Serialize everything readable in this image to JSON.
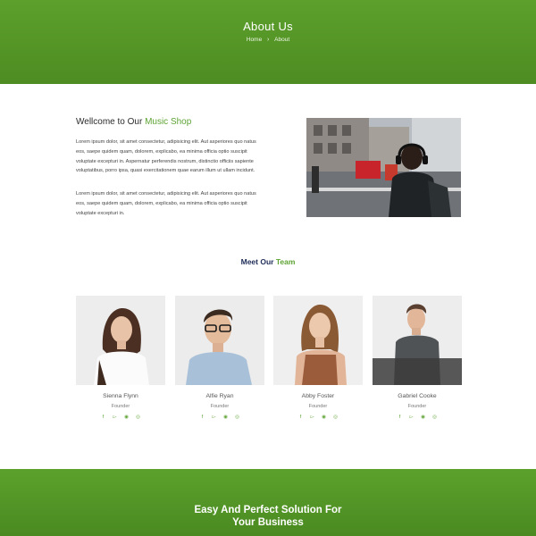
{
  "hero": {
    "title": "About Us",
    "breadcrumb": {
      "home": "Home",
      "separator": "›",
      "current": "About"
    }
  },
  "welcome": {
    "title_prefix": "Wellcome to Our ",
    "title_accent": "Music Shop",
    "paragraph_1": "Lorem ipsum dolor, sit amet consectetur, adipisicing elit. Aut asperiores quo natus eos, saepe quidem quam, dolorem, explicabo, ea minima officia optio suscipit voluptate excepturi in. Aspernatur perferendis nostrum, distinctio officiis sapiente voluptatibus, porro ipsa, quasi exercitationem quae earum illum ut ullam incidunt.",
    "paragraph_2": "Lorem ipsum dolor, sit amet consectetur, adipisicing elit. Aut asperiores quo natus eos, saepe quidem quam, dolorem, explicabo, ea minima officia optio suscipit voluptate excepturi in."
  },
  "team": {
    "title_prefix": "Meet Our ",
    "title_accent": "Team",
    "members": [
      {
        "name": "Sienna Flynn",
        "role": "Founder"
      },
      {
        "name": "Alfie Ryan",
        "role": "Founder"
      },
      {
        "name": "Abby Foster",
        "role": "Founder"
      },
      {
        "name": "Gabriel Cooke",
        "role": "Founder"
      }
    ],
    "social_icons": [
      "facebook-icon",
      "twitter-icon",
      "pinterest-icon",
      "dribbble-icon"
    ]
  },
  "footer": {
    "title_line_1": "Easy And Perfect Solution For",
    "title_line_2": "Your Business"
  },
  "colors": {
    "accent_green": "#5ea334",
    "hero_green": "#569a28",
    "heading_navy": "#22305a"
  }
}
